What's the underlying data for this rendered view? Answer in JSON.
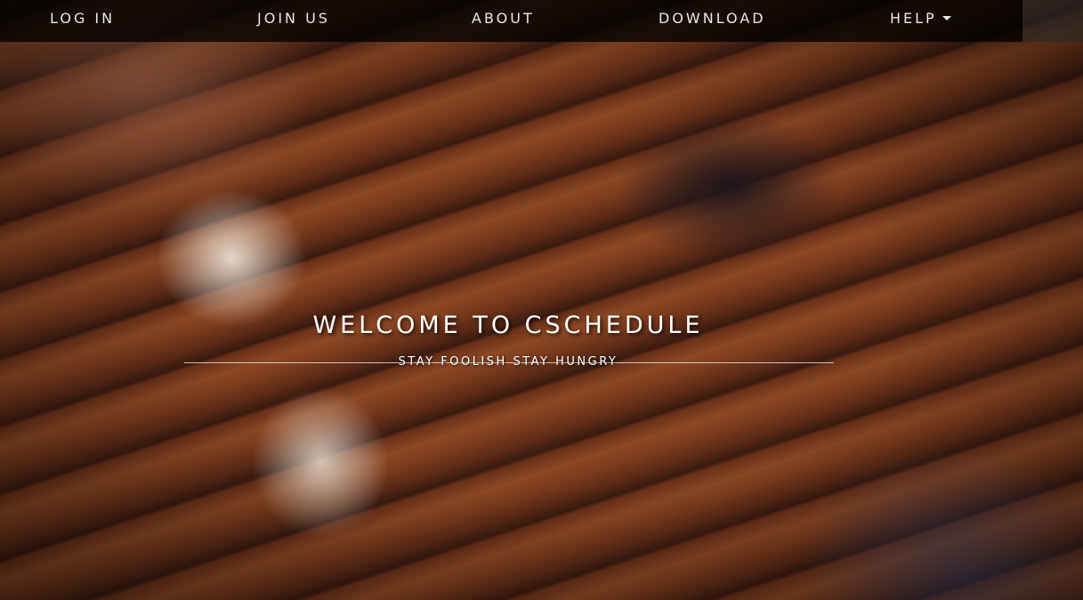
{
  "nav": {
    "items": [
      {
        "label": "LOG IN"
      },
      {
        "label": "JOIN US"
      },
      {
        "label": "ABOUT"
      },
      {
        "label": "DOWNLOAD"
      },
      {
        "label": "HELP"
      }
    ],
    "help_icon": "caret-down-icon"
  },
  "hero": {
    "title": "WELCOME TO CSCHEDULE",
    "subtitle": "STAY FOOLISH STAY HUNGRY",
    "background": "photo of people holding coffee mugs on wooden table"
  }
}
